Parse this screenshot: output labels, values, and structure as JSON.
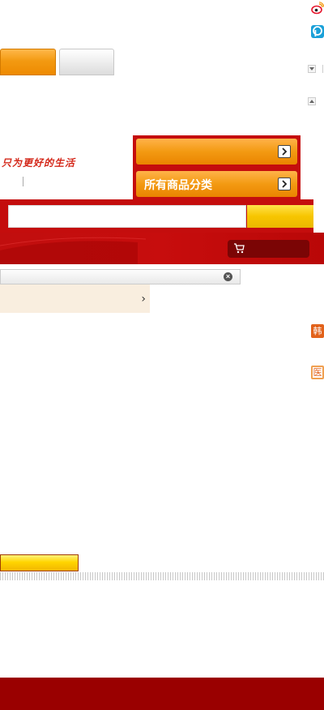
{
  "brand": {
    "slogan": "只为更好的生活"
  },
  "share": {
    "weibo_icon": "weibo-icon",
    "pengyou_icon": "pengyou-icon"
  },
  "tabs": {
    "primary_label": "",
    "secondary_label": ""
  },
  "categories": {
    "top_label": "",
    "all_label": "所有商品分类"
  },
  "search": {
    "placeholder": "",
    "value": "",
    "button_label": ""
  },
  "cart": {
    "label": ""
  },
  "dropdown": {
    "item_label": ""
  },
  "side_badges": [
    "韩",
    "医"
  ],
  "colors": {
    "brand_red": "#c40d0d",
    "orange": "#f39a12",
    "yellow": "#f7c500",
    "footer_red": "#9a0000",
    "dropdown_bg": "#f9eedf"
  }
}
